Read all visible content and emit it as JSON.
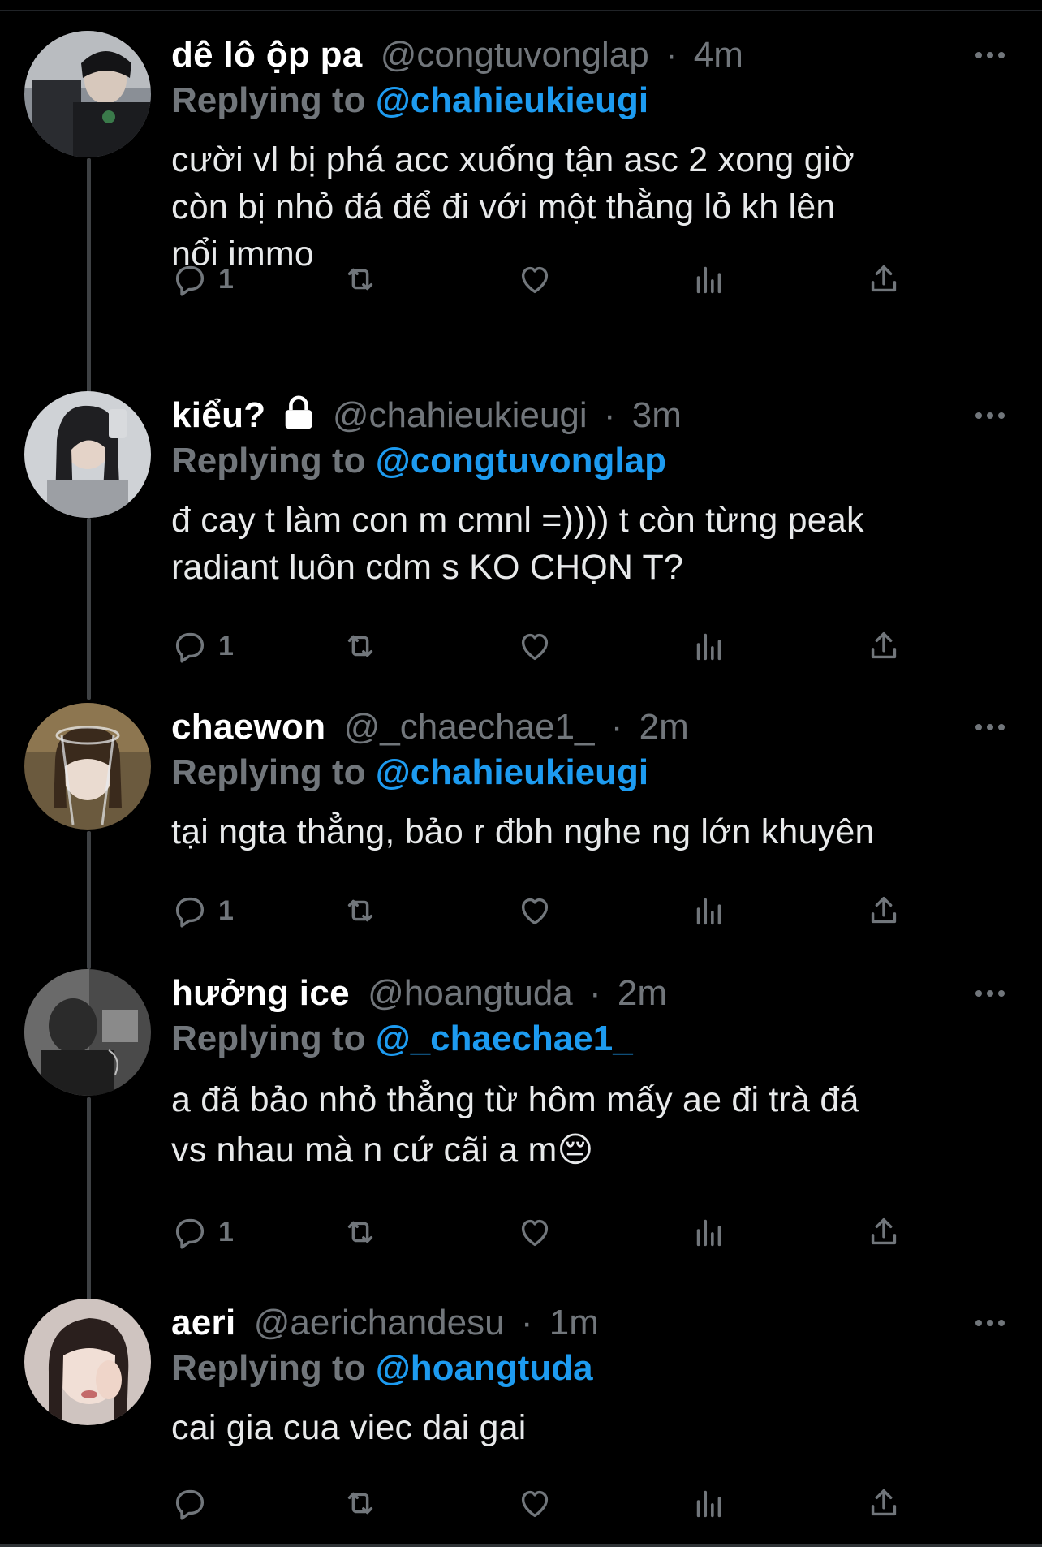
{
  "tweets": [
    {
      "display_name": "dê lô ộp pa",
      "handle": "@congtuvonglap",
      "separator": "·",
      "time": "4m",
      "replying_label": "Replying to",
      "replying_to": "@chahieukieugi",
      "body_lines": [
        "cười vl bị phá acc xuống tận asc 2 xong giờ",
        "còn bị nhỏ đá để đi với một thằng lỏ kh lên",
        "nổi immo"
      ],
      "reply_count": "1",
      "locked": false
    },
    {
      "display_name": "kiểu?",
      "handle": "@chahieukieugi",
      "separator": "·",
      "time": "3m",
      "replying_label": "Replying to",
      "replying_to": "@congtuvonglap",
      "body_lines": [
        "đ cay t làm con m cmnl =)))) t còn từng peak",
        "radiant luôn cdm s KO CHỌN T?"
      ],
      "reply_count": "1",
      "locked": true
    },
    {
      "display_name": "chaewon",
      "handle": "@_chaechae1_",
      "separator": "·",
      "time": "2m",
      "replying_label": "Replying to",
      "replying_to": "@chahieukieugi",
      "body_lines": [
        "tại ngta thẳng, bảo r đbh nghe ng lớn khuyên"
      ],
      "reply_count": "1",
      "locked": false
    },
    {
      "display_name": "hưởng ice",
      "handle": "@hoangtuda",
      "separator": "·",
      "time": "2m",
      "replying_label": "Replying to",
      "replying_to": "@_chaechae1_",
      "body_lines": [
        "a đã bảo nhỏ thẳng từ hôm mấy ae đi trà đá",
        "vs nhau mà n cứ cãi a m😔"
      ],
      "reply_count": "1",
      "locked": false
    },
    {
      "display_name": "aeri",
      "handle": "@aerichandesu",
      "separator": "·",
      "time": "1m",
      "replying_label": "Replying to",
      "replying_to": "@hoangtuda",
      "body_lines": [
        "cai gia cua viec dai gai"
      ],
      "reply_count": "",
      "locked": false
    }
  ],
  "icons": {
    "reply": "reply-icon",
    "retweet": "retweet-icon",
    "like": "heart-icon",
    "views": "views-icon",
    "share": "share-icon",
    "more": "more-icon",
    "lock": "lock-icon"
  },
  "colors": {
    "background": "#000000",
    "text": "#e7e9ea",
    "muted": "#71767b",
    "mention": "#1d9bf0",
    "thread_line": "#3e4144"
  }
}
